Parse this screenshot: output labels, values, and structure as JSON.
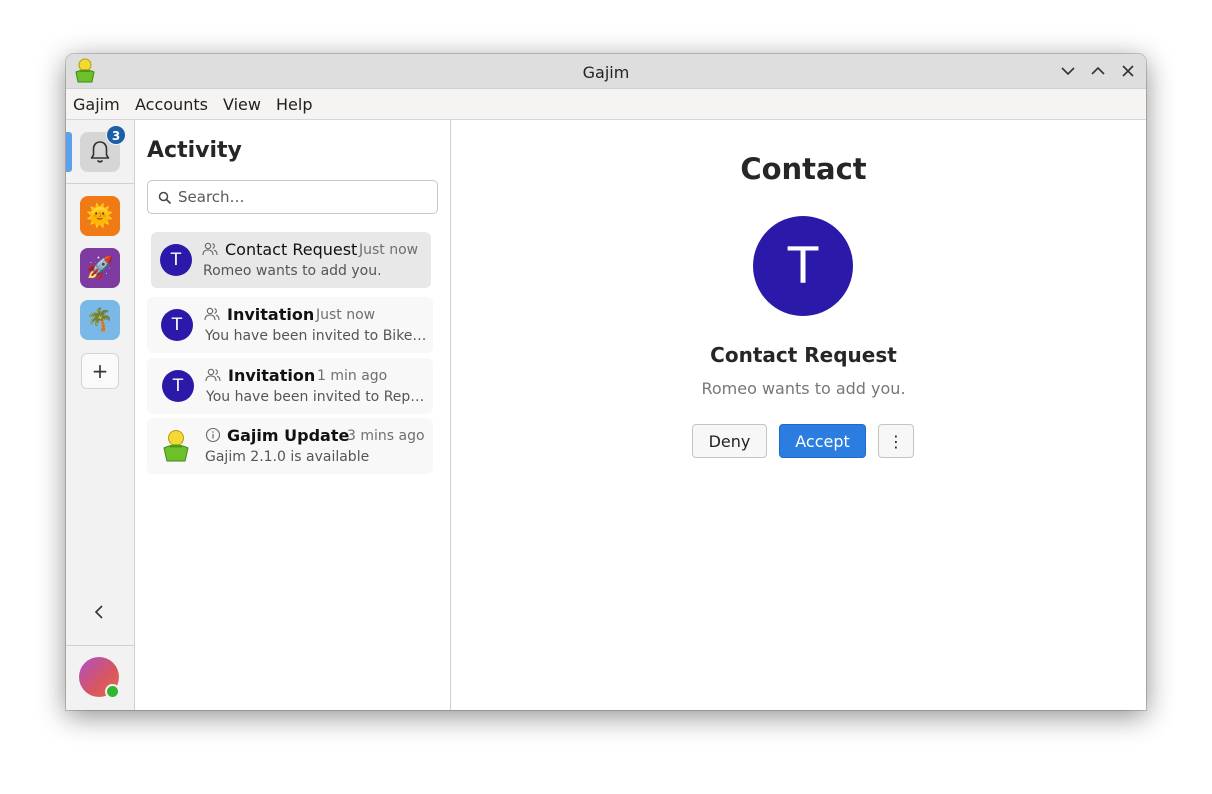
{
  "window": {
    "title": "Gajim"
  },
  "menu": [
    "Gajim",
    "Accounts",
    "View",
    "Help"
  ],
  "sidebar": {
    "notification_count": "3",
    "accounts": [
      {
        "emoji": "🌞",
        "color": "#f07a16"
      },
      {
        "emoji": "🚀",
        "color": "#7d3aa0"
      },
      {
        "emoji": "🌴",
        "color": "#7ab8e8"
      }
    ],
    "add_label": "+"
  },
  "activity": {
    "title": "Activity",
    "search_placeholder": "Search…",
    "items": [
      {
        "avatar": "T",
        "title": "Contact Request",
        "time": "Just now",
        "subtitle": "Romeo wants to add you."
      },
      {
        "avatar": "T",
        "title": "Invitation",
        "time": "Just now",
        "subtitle": "You have been invited to Bike…"
      },
      {
        "avatar": "T",
        "title": "Invitation",
        "time": "1 min ago",
        "subtitle": "You have been invited to Rep…"
      },
      {
        "avatar": "",
        "title": "Gajim Update",
        "time": "3 mins ago",
        "subtitle": "Gajim 2.1.0 is available"
      }
    ]
  },
  "detail": {
    "heading": "Contact",
    "avatar": "T",
    "title": "Contact Request",
    "text": "Romeo wants to add you.",
    "deny_label": "Deny",
    "accept_label": "Accept",
    "more_label": "⋮"
  },
  "colors": {
    "accent": "#2b7ee0",
    "avatar": "#2b1aaa",
    "badge": "#1c5ea8",
    "online": "#2fb82f"
  }
}
